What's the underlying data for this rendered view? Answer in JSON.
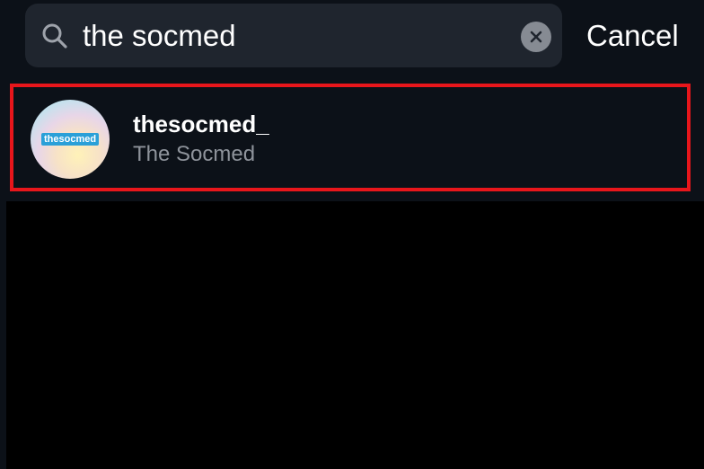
{
  "search": {
    "value": "the socmed",
    "cancel_label": "Cancel",
    "icon": "search-icon",
    "clear_icon": "close-circle-icon"
  },
  "results": [
    {
      "username": "thesocmed_",
      "display_name": "The Socmed",
      "avatar_text": "thesocmed"
    }
  ],
  "colors": {
    "background": "#000000",
    "header_background": "#0c1118",
    "search_background": "#1f252e",
    "highlight_border": "#e8161b",
    "primary_text": "#ffffff",
    "secondary_text": "#8e939b"
  }
}
